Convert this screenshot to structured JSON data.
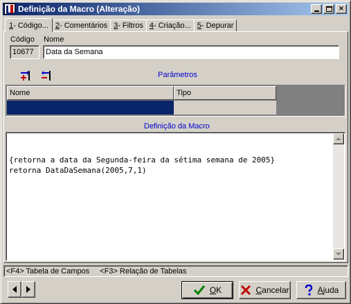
{
  "window": {
    "title": "Definição da Macro (Alteração)",
    "controls": {
      "minimize": "",
      "maximize": "",
      "close": "×"
    }
  },
  "tabs": [
    {
      "key": "1",
      "label": " - Código..."
    },
    {
      "key": "2",
      "label": " - Comentários"
    },
    {
      "key": "3",
      "label": " - Filtros"
    },
    {
      "key": "4",
      "label": " - Criação..."
    },
    {
      "key": "5",
      "label": "- Depurar"
    }
  ],
  "codigo": {
    "label": "Código",
    "value": "10677"
  },
  "nome": {
    "label": "Nome",
    "value": "Data da Semana"
  },
  "parametros": {
    "title": "Parâmetros",
    "columns": [
      "Nome",
      "Tipo"
    ]
  },
  "definicao": {
    "title": "Definição da Macro",
    "lines": [
      "{retorna a data da Segunda-feira da sétima semana de 2005}",
      "retorna DataDaSemana(2005,7,1)"
    ]
  },
  "status": {
    "campos": "<F4> Tabela de Campos",
    "tabelas": "<F3> Relação de Tabelas"
  },
  "buttons": {
    "ok": {
      "key": "O",
      "rest": "K"
    },
    "cancelar": {
      "key": "C",
      "rest": "ancelar"
    },
    "ajuda": {
      "key": "A",
      "rest": "juda"
    }
  },
  "colors": {
    "title_bar": "#0a246a",
    "selection": "#0a246a",
    "section_label": "#0000cc",
    "ok_icon": "#008000",
    "cancel_icon": "#c00000",
    "help_icon": "#0000cc"
  }
}
